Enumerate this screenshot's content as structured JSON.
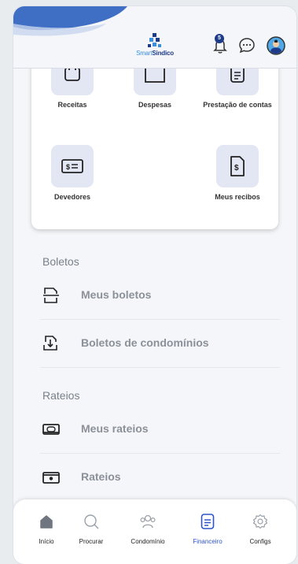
{
  "header": {
    "logo_smart": "Smart",
    "logo_sindico": "Sindico",
    "notifications_count": "5"
  },
  "financeiro_card": {
    "tiles": [
      {
        "label": "Receitas",
        "icon": "receipt-icon"
      },
      {
        "label": "Despesas",
        "icon": "expenses-icon"
      },
      {
        "label": "Prestação de contas",
        "icon": "document-list-icon"
      },
      {
        "label": "Devedores",
        "icon": "money-bill-icon"
      },
      {
        "label": "Meus recibos",
        "icon": "receipt-dollar-icon"
      }
    ]
  },
  "sections": {
    "boletos_title": "Boletos",
    "boletos_items": [
      {
        "label": "Meus boletos",
        "icon": "boleto-icon"
      },
      {
        "label": "Boletos de condomínios",
        "icon": "boleto-download-icon"
      }
    ],
    "rateios_title": "Rateios",
    "rateios_items": [
      {
        "label": "Meus rateios",
        "icon": "money-bill-icon"
      },
      {
        "label": "Rateios",
        "icon": "wallet-icon"
      }
    ]
  },
  "tabbar": {
    "items": [
      {
        "label": "Início",
        "icon": "home-icon"
      },
      {
        "label": "Procurar",
        "icon": "search-icon"
      },
      {
        "label": "Condomínio",
        "icon": "people-icon"
      },
      {
        "label": "Financeiro",
        "icon": "document-icon"
      },
      {
        "label": "Configs",
        "icon": "gear-icon"
      }
    ],
    "active": "Financeiro"
  },
  "colors": {
    "brand_dark": "#1e3b8a",
    "brand_light": "#3a8fe0",
    "active_tab": "#2e55c7",
    "tile_bg": "#e3e7f3"
  }
}
